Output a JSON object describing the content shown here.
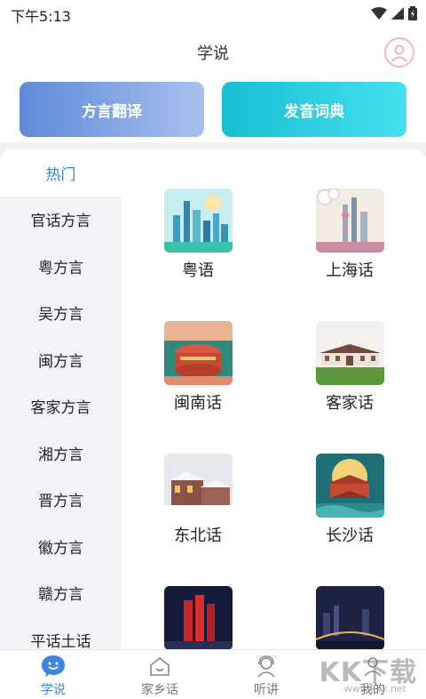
{
  "status": {
    "time": "下午5:13"
  },
  "header": {
    "title": "学说"
  },
  "features": {
    "translate": "方言翻译",
    "dictionary": "发音词典"
  },
  "sidebar": {
    "items": [
      {
        "label": "热门",
        "active": true
      },
      {
        "label": "官话方言"
      },
      {
        "label": "粤方言"
      },
      {
        "label": "吴方言"
      },
      {
        "label": "闽方言"
      },
      {
        "label": "客家方言"
      },
      {
        "label": "湘方言"
      },
      {
        "label": "晋方言"
      },
      {
        "label": "徽方言"
      },
      {
        "label": "赣方言"
      },
      {
        "label": "平话土话"
      }
    ]
  },
  "dialects": [
    {
      "label": "粤语",
      "icon": "city-skyline-thumbnail"
    },
    {
      "label": "上海话",
      "icon": "shanghai-tower-thumbnail"
    },
    {
      "label": "闽南话",
      "icon": "tulou-illustration-thumbnail"
    },
    {
      "label": "客家话",
      "icon": "hakka-building-thumbnail"
    },
    {
      "label": "东北话",
      "icon": "snow-town-thumbnail"
    },
    {
      "label": "长沙话",
      "icon": "moon-pavilion-thumbnail"
    },
    {
      "label": "",
      "icon": "night-building-thumbnail"
    },
    {
      "label": "",
      "icon": "night-bridge-thumbnail"
    }
  ],
  "nav": [
    {
      "label": "学说",
      "active": true
    },
    {
      "label": "家乡话"
    },
    {
      "label": "听讲"
    },
    {
      "label": "我的"
    }
  ],
  "watermark": {
    "text": "KK下载",
    "url": "www.kkx.net"
  },
  "colors": {
    "accent": "#3b86e0",
    "translate_btn": "#5d8ad8",
    "dict_btn": "#17bfd4"
  }
}
